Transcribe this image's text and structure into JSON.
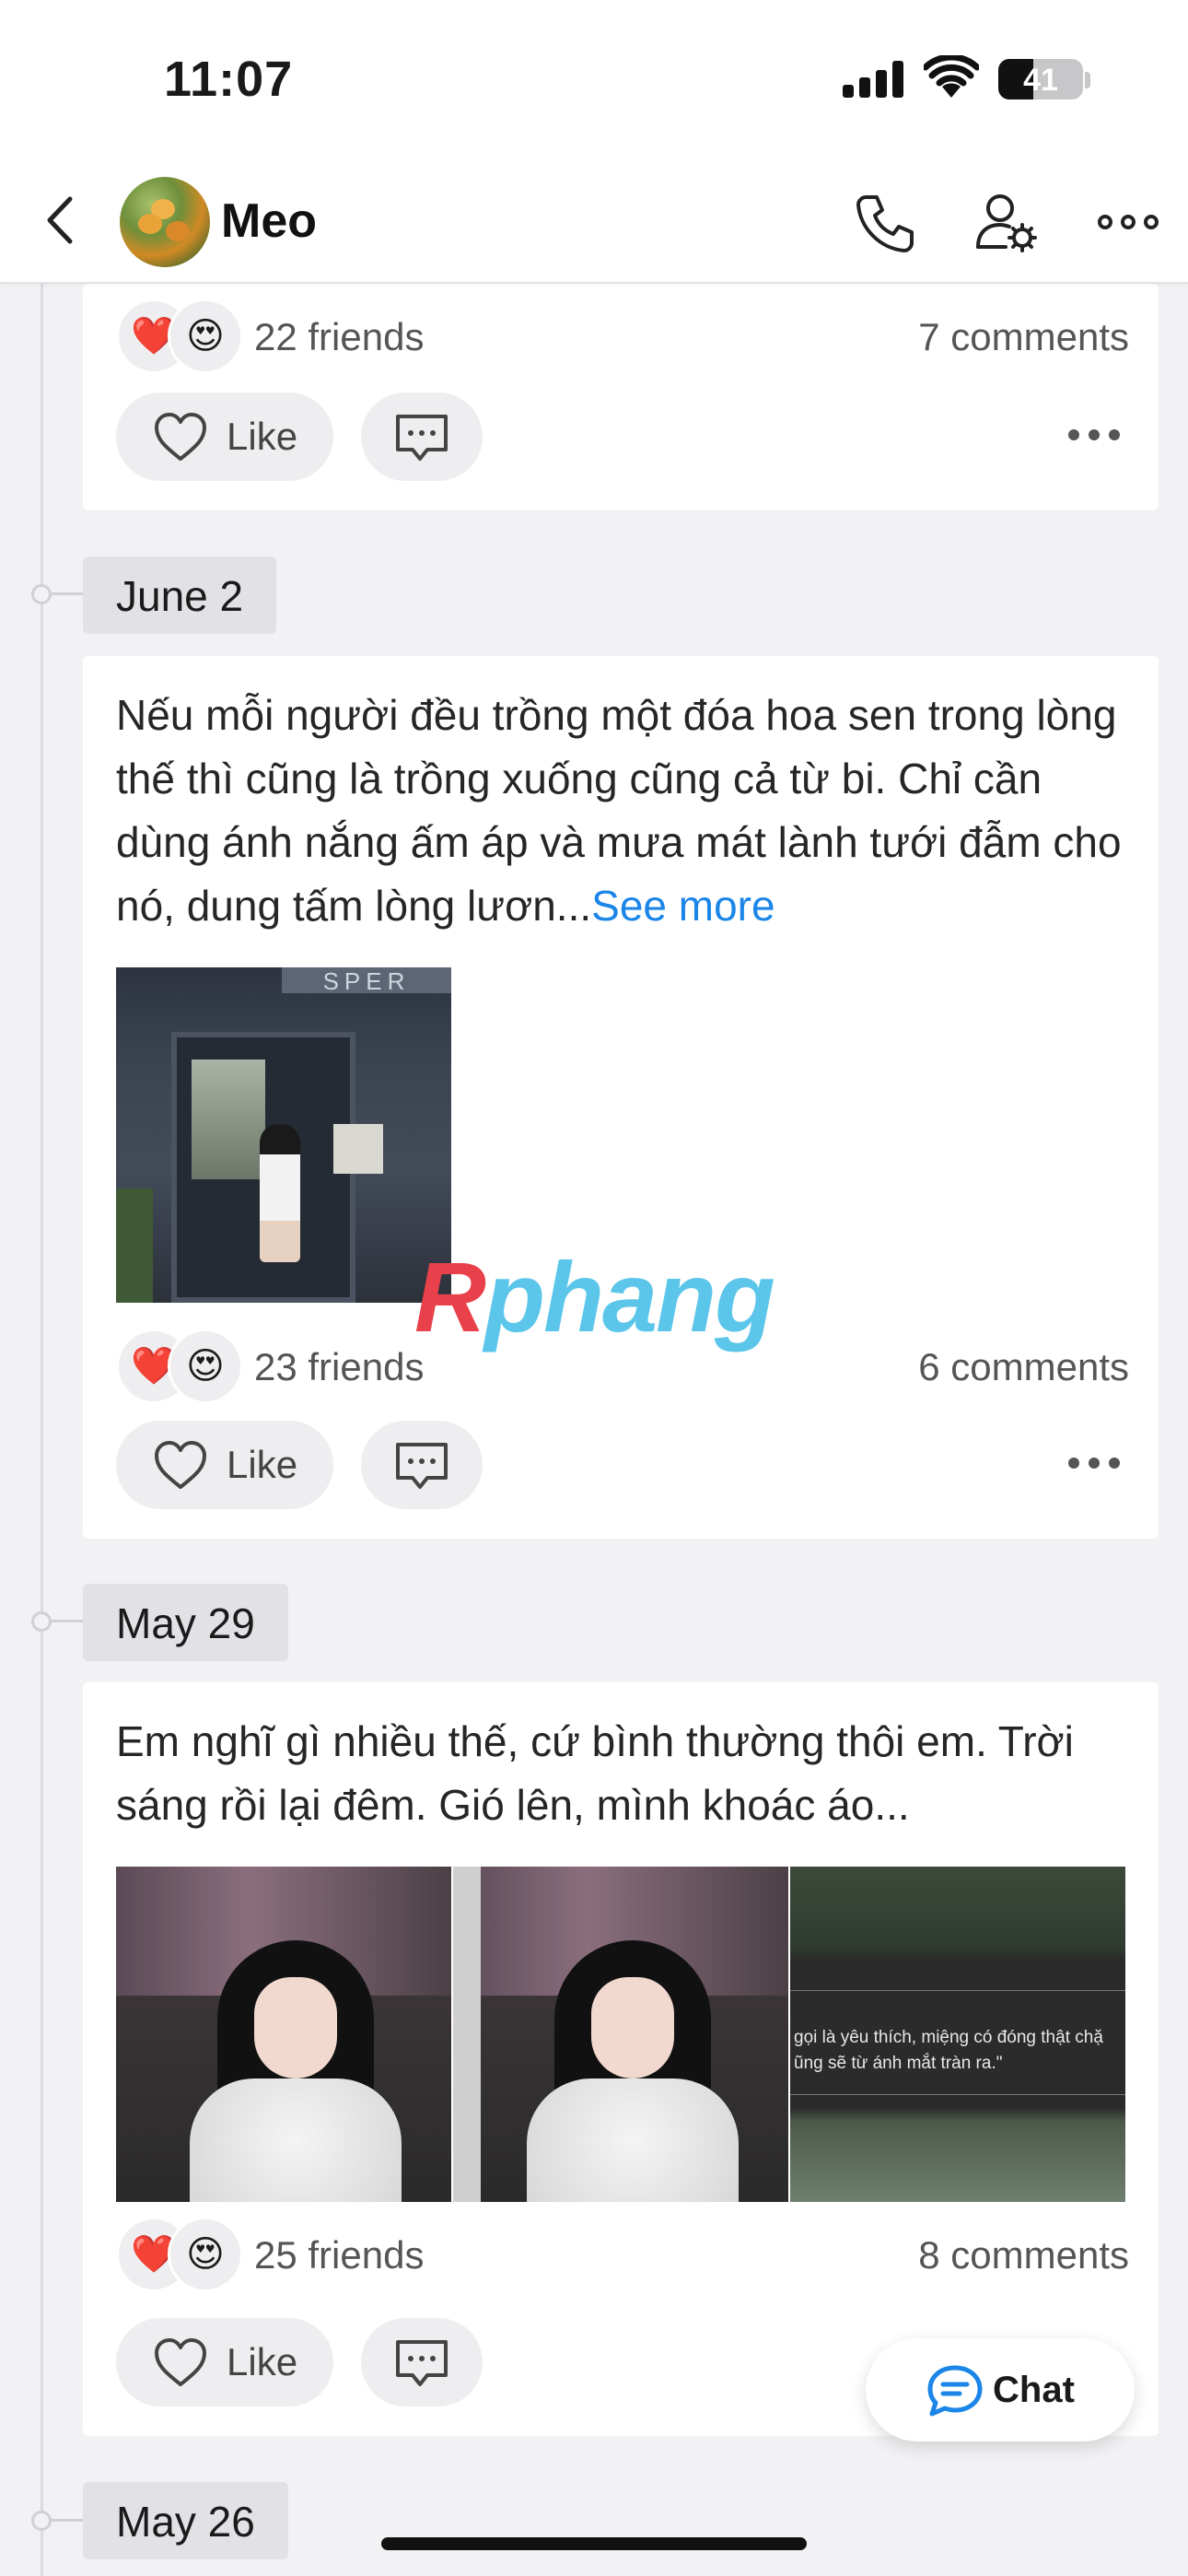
{
  "status_bar": {
    "time": "11:07",
    "battery_level": "41",
    "battery_fraction": 0.41,
    "icons": [
      "cellular-signal-icon",
      "wifi-icon",
      "battery-icon"
    ]
  },
  "header": {
    "title": "Meo",
    "icons": [
      "back-chevron-icon",
      "avatar",
      "phone-icon",
      "user-settings-icon",
      "more-horizontal-icon"
    ]
  },
  "posts": [
    {
      "date": "",
      "reactions": [
        "❤️",
        "😍"
      ],
      "friends_label": "22 friends",
      "comments_label": "7 comments",
      "like_label": "Like"
    },
    {
      "date": "June 2",
      "text": "Nếu mỗi người đều trồng một đóa hoa sen trong lòng thế thì cũng là trồng xuống cũng cả từ bi. Chỉ cần dùng ánh nắng ấm áp và mưa mát lành tưới đẫm cho nó, dung tấm lòng lươn...",
      "see_more": "See more",
      "image_sign_text": "SPER",
      "reactions": [
        "❤️",
        "😍"
      ],
      "friends_label": "23 friends",
      "comments_label": "6 comments",
      "like_label": "Like"
    },
    {
      "date": "May 29",
      "text": "Em nghĩ gì nhiều thế, cứ bình thường thôi em. Trời sáng rồi lại đêm. Gió lên, mình khoác áo...",
      "image_quote_lines": [
        "gọi là yêu thích, miệng có đóng thật chặ",
        "ũng sẽ từ ánh mắt tràn ra.\""
      ],
      "reactions": [
        "❤️",
        "😍"
      ],
      "friends_label": "25 friends",
      "comments_label": "8 comments",
      "like_label": "Like"
    },
    {
      "date": "May 26"
    }
  ],
  "watermark": {
    "part1": "R",
    "part2": "phang"
  },
  "chat_fab": {
    "label": "Chat"
  },
  "colors": {
    "link_blue": "#1b86e8",
    "page_background": "#f2f2f4",
    "chip_background": "#e2e2e6"
  }
}
